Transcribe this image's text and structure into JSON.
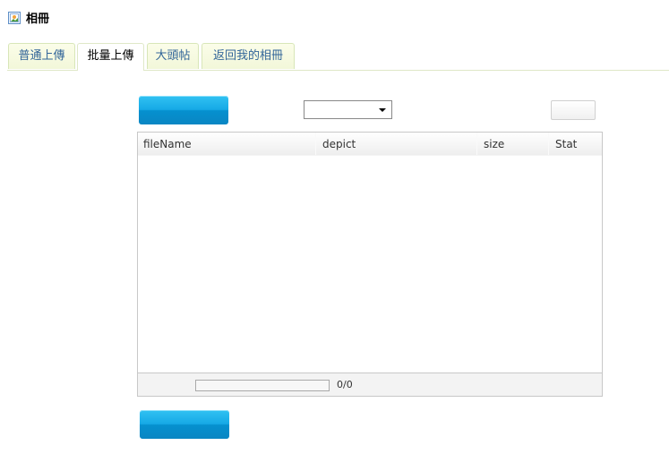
{
  "page": {
    "title": "相冊",
    "icon": "photo-album-icon"
  },
  "tabs": [
    {
      "label": "普通上傳",
      "active": false
    },
    {
      "label": "批量上傳",
      "active": true
    },
    {
      "label": "大頭帖",
      "active": false
    },
    {
      "label": "返回我的相冊",
      "active": false
    }
  ],
  "upload": {
    "album_select_value": "",
    "columns": [
      "fileName",
      "depict",
      "size",
      "Stat"
    ],
    "rows": [],
    "progress_fraction": 0,
    "progress_text": "0/0"
  },
  "colors": {
    "tab_text": "#336699",
    "button_blue": "#16a9e6"
  }
}
